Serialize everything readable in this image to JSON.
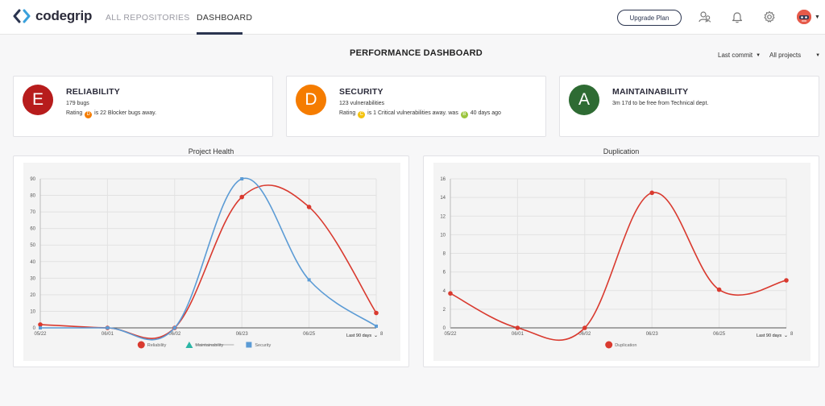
{
  "app": {
    "logo_text": "codegrip"
  },
  "nav": {
    "repos_label": "ALL REPOSITORIES",
    "dashboard_label": "DASHBOARD"
  },
  "header": {
    "upgrade_label": "Upgrade Plan",
    "icons": [
      "team-icon",
      "bell-icon",
      "gear-icon",
      "avatar"
    ]
  },
  "page": {
    "title": "PERFORMANCE DASHBOARD"
  },
  "filters": {
    "commit_label": "Last commit",
    "projects_label": "All projects"
  },
  "cards": [
    {
      "grade": "E",
      "grade_color": "#b71c1c",
      "title": "RELIABILITY",
      "count": "179 bugs",
      "rating_prefix": "Rating",
      "rating_badge": "D",
      "rating_badge_color": "#f57c00",
      "rating_text": "is 22 Blocker bugs away."
    },
    {
      "grade": "D",
      "grade_color": "#f57c00",
      "title": "SECURITY",
      "count": "123 vulnerabilities",
      "rating_prefix": "Rating",
      "rating_badge": "C",
      "rating_badge_color": "#f4c20d",
      "rating_text": "is 1 Critical vulnerabilities away. was",
      "was_badge": "B",
      "was_badge_color": "#9bc53d",
      "was_text": "40 days ago"
    },
    {
      "grade": "A",
      "grade_color": "#2e6b33",
      "title": "MAINTAINABILITY",
      "count": "3m 17d to be free from Technical dept."
    }
  ],
  "chart_data": [
    {
      "type": "line",
      "title": "Project Health",
      "x": [
        "05/22",
        "06/01",
        "06/02",
        "06/23",
        "06/25",
        "8"
      ],
      "ylim": [
        0,
        90
      ],
      "yticks": [
        0,
        10,
        20,
        30,
        40,
        50,
        60,
        70,
        80,
        90
      ],
      "grid": true,
      "legend_position": "bottom",
      "range_label": "Last 90 days",
      "series": [
        {
          "name": "Reliability",
          "color": "#d93a2f",
          "marker": "circle",
          "values": [
            2,
            0,
            0,
            79,
            73,
            9
          ]
        },
        {
          "name": "Maintainability",
          "color": "#2bb5a5",
          "marker": "triangle",
          "hidden": true,
          "values": []
        },
        {
          "name": "Security",
          "color": "#5b9bd5",
          "marker": "square",
          "values": [
            0,
            0,
            0,
            90,
            29,
            1
          ]
        }
      ]
    },
    {
      "type": "line",
      "title": "Duplication",
      "x": [
        "05/22",
        "06/01",
        "06/02",
        "06/23",
        "06/25",
        "8"
      ],
      "ylim": [
        0,
        16
      ],
      "yticks": [
        0,
        2,
        4,
        6,
        8,
        10,
        12,
        14,
        16
      ],
      "grid": true,
      "legend_position": "bottom",
      "range_label": "Last 90 days",
      "series": [
        {
          "name": "Duplication",
          "color": "#d93a2f",
          "marker": "circle",
          "values": [
            3.7,
            0,
            0,
            14.5,
            4.1,
            5.1
          ]
        }
      ]
    }
  ]
}
